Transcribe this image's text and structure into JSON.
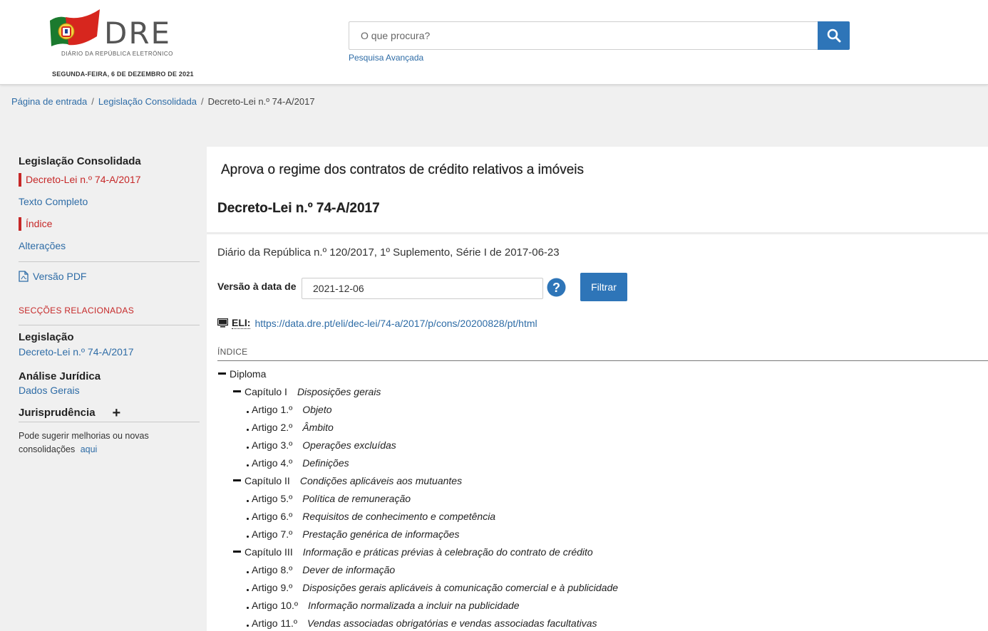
{
  "header": {
    "logo_text": "DRE",
    "logo_subtitle": "DIÁRIO DA REPÚBLICA ELETRÓNICO",
    "date": "SEGUNDA-FEIRA, 6 DE DEZEMBRO DE 2021",
    "search_placeholder": "O que procura?",
    "advanced_search": "Pesquisa Avançada"
  },
  "breadcrumb": {
    "home": "Página de entrada",
    "section": "Legislação Consolidada",
    "current": "Decreto-Lei n.º 74-A/2017"
  },
  "sidebar": {
    "title": "Legislação Consolidada",
    "active_doc": "Decreto-Lei n.º 74-A/2017",
    "full_text": "Texto Completo",
    "index": "Índice",
    "changes": "Alterações",
    "pdf": "Versão PDF",
    "related_title": "SECÇÕES RELACIONADAS",
    "legislation_h": "Legislação",
    "legislation_link": "Decreto-Lei n.º 74-A/2017",
    "legal_analysis_h": "Análise Jurídica",
    "legal_analysis_link": "Dados Gerais",
    "jurisprudence_h": "Jurisprudência",
    "jurisprudence_toggle": "+",
    "suggest_text": "Pode sugerir melhorias ou novas consolidações",
    "suggest_link": "aqui"
  },
  "main": {
    "title": "Aprova o regime dos contratos de crédito relativos a imóveis",
    "subtitle": "Decreto-Lei n.º 74-A/2017",
    "dr_line": "Diário da República n.º 120/2017, 1º Suplemento, Série I de 2017-06-23",
    "version_label": "Versão à data de",
    "version_value": "2021-12-06",
    "filter_button": "Filtrar",
    "eli_label": "ELI:",
    "eli_url": "https://data.dre.pt/eli/dec-lei/74-a/2017/p/cons/20200828/pt/html",
    "index_label": "ÍNDICE"
  },
  "index_tree": [
    {
      "level": 0,
      "label": "Diploma",
      "title": ""
    },
    {
      "level": 1,
      "label": "Capítulo I",
      "title": "Disposições gerais"
    },
    {
      "level": 2,
      "label": "Artigo 1.º",
      "title": "Objeto"
    },
    {
      "level": 2,
      "label": "Artigo 2.º",
      "title": "Âmbito"
    },
    {
      "level": 2,
      "label": "Artigo 3.º",
      "title": "Operações excluídas"
    },
    {
      "level": 2,
      "label": "Artigo 4.º",
      "title": "Definições"
    },
    {
      "level": 1,
      "label": "Capítulo II",
      "title": "Condições aplicáveis aos mutuantes"
    },
    {
      "level": 2,
      "label": "Artigo 5.º",
      "title": "Política de remuneração"
    },
    {
      "level": 2,
      "label": "Artigo 6.º",
      "title": "Requisitos de conhecimento e competência"
    },
    {
      "level": 2,
      "label": "Artigo 7.º",
      "title": "Prestação genérica de informações"
    },
    {
      "level": 1,
      "label": "Capítulo III",
      "title": "Informação e práticas prévias à celebração do contrato de crédito"
    },
    {
      "level": 2,
      "label": "Artigo 8.º",
      "title": "Dever de informação"
    },
    {
      "level": 2,
      "label": "Artigo 9.º",
      "title": "Disposições gerais aplicáveis à comunicação comercial e à publicidade"
    },
    {
      "level": 2,
      "label": "Artigo 10.º",
      "title": "Informação normalizada a incluir na publicidade"
    },
    {
      "level": 2,
      "label": "Artigo 11.º",
      "title": "Vendas associadas obrigatórias e vendas associadas facultativas"
    }
  ],
  "colors": {
    "accent_blue": "#2e75b8",
    "link_blue": "#2e6ca6",
    "active_red": "#c62828"
  }
}
